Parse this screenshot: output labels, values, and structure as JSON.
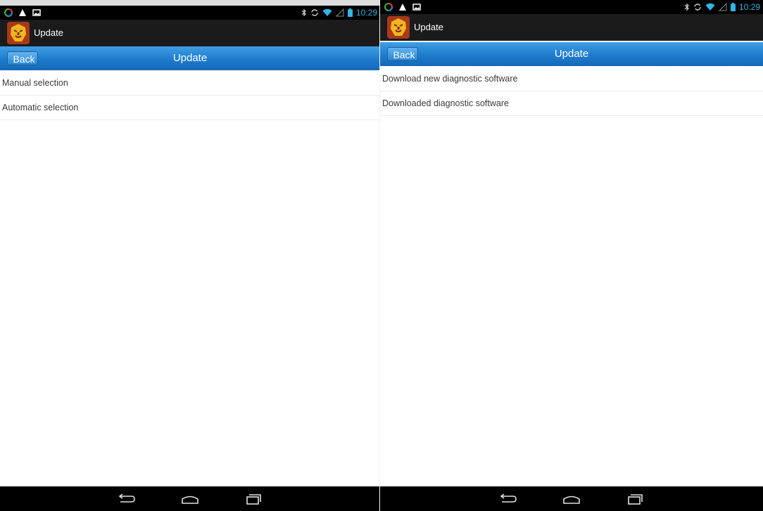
{
  "colors": {
    "status_time": "#33b5e5",
    "title_bar": "#1e7bcd",
    "action_bar": "#1b1b1b",
    "list_text": "#3a3a3a"
  },
  "screens": [
    {
      "status_bar": {
        "left_icons": [
          "lollipop-icon",
          "warning-icon",
          "image-icon"
        ],
        "right_icons": [
          "bluetooth-icon",
          "sync-icon",
          "wifi-icon",
          "signal-icon",
          "battery-icon"
        ],
        "time": "10:29"
      },
      "app_title": "Update",
      "title_bar": {
        "back_label": "Back",
        "title": "Update"
      },
      "items": [
        "Manual selection",
        "Automatic selection"
      ],
      "nav": [
        "back-nav-icon",
        "home-nav-icon",
        "recents-nav-icon"
      ]
    },
    {
      "status_bar": {
        "left_icons": [
          "lollipop-icon",
          "warning-icon",
          "image-icon"
        ],
        "right_icons": [
          "bluetooth-icon",
          "sync-icon",
          "wifi-icon",
          "signal-icon",
          "battery-icon"
        ],
        "time": "10:29"
      },
      "app_title": "Update",
      "title_bar": {
        "back_label": "Back",
        "title": "Update"
      },
      "items": [
        "Download new diagnostic software",
        "Downloaded diagnostic software"
      ],
      "nav": [
        "back-nav-icon",
        "home-nav-icon",
        "recents-nav-icon"
      ]
    }
  ]
}
